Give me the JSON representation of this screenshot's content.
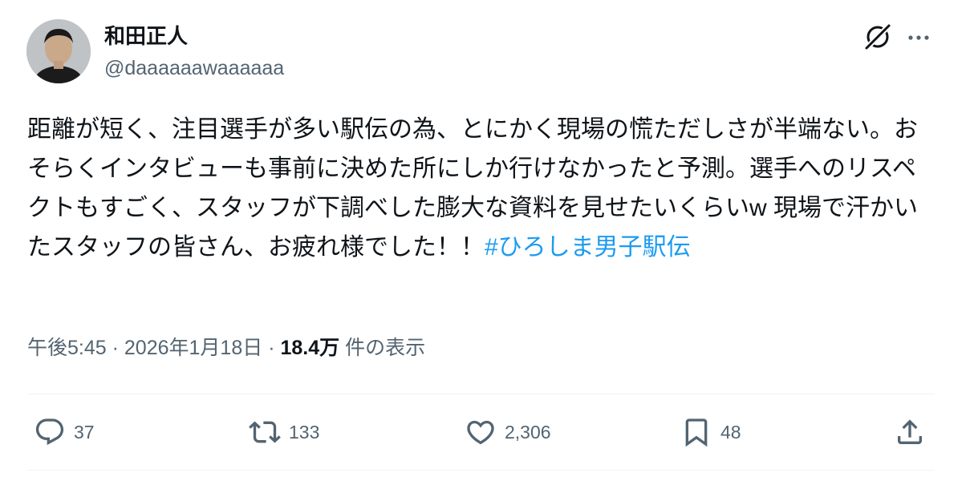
{
  "user": {
    "display_name": "和田正人",
    "handle": "@daaaaaawaaaaaa",
    "avatar_icon": "avatar"
  },
  "header_actions": {
    "grok_icon": "grok-icon",
    "more_icon": "more-dots-icon"
  },
  "tweet": {
    "text": "距離が短く、注目選手が多い駅伝の為、とにかく現場の慌ただしさが半端ない。おそらくインタビューも事前に決めた所にしか行けなかったと予測。選手へのリスペクトもすごく、スタッフが下調べした膨大な資料を見せたいくらいw 現場で汗かいたスタッフの皆さん、お疲れ様でした！！",
    "hashtag": "#ひろしま男子駅伝"
  },
  "meta": {
    "time": "午後5:45",
    "separator": "·",
    "date": "2026年1月18日",
    "views": "18.4万",
    "views_label": "件の表示"
  },
  "actions": {
    "replies": "37",
    "retweets": "133",
    "likes": "2,306",
    "bookmarks": "48"
  },
  "colors": {
    "text": "#0f1419",
    "secondary": "#536471",
    "link": "#1d9bf0",
    "divider": "#eff3f4"
  }
}
